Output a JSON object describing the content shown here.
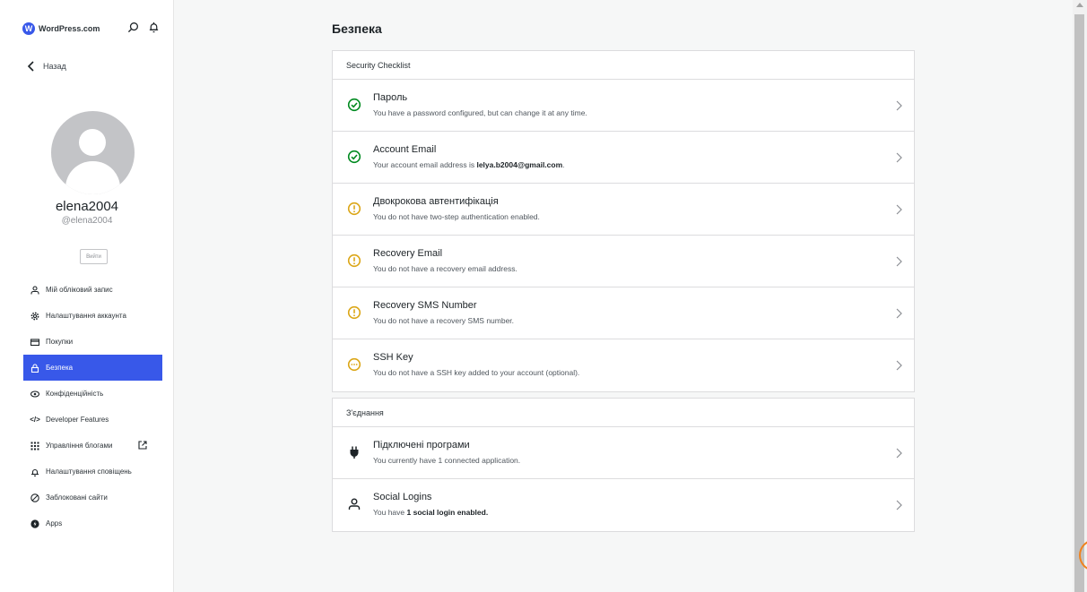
{
  "sidebar": {
    "brand": "WordPress.com",
    "back_label": "Назад",
    "username": "elena2004",
    "handle": "@elena2004",
    "logout_label": "Вийти",
    "items": [
      {
        "label": "Мій обліковий запис",
        "icon": "person-icon"
      },
      {
        "label": "Налаштування аккаунта",
        "icon": "gear-icon"
      },
      {
        "label": "Покупки",
        "icon": "card-icon"
      },
      {
        "label": "Безпека",
        "icon": "lock-icon",
        "active": true
      },
      {
        "label": "Конфіденційність",
        "icon": "eye-icon"
      },
      {
        "label": "Developer Features",
        "icon": "code-icon"
      },
      {
        "label": "Управління блогами",
        "icon": "grid-icon"
      },
      {
        "label": "Налаштування сповіщень",
        "icon": "bell-icon"
      },
      {
        "label": "Заблоковані сайти",
        "icon": "block-icon"
      },
      {
        "label": "Apps",
        "icon": "apps-icon"
      }
    ]
  },
  "main": {
    "title": "Безпека",
    "checklist": {
      "heading": "Security Checklist",
      "rows": [
        {
          "title": "Пароль",
          "desc": "You have a password configured, but can change it at any time.",
          "status": "ok"
        },
        {
          "title": "Account Email",
          "desc_prefix": "Your account email address is ",
          "desc_bold": "lelya.b2004@gmail.com",
          "desc_suffix": ".",
          "status": "ok"
        },
        {
          "title": "Двокрокова автентифікація",
          "desc": "You do not have two-step authentication enabled.",
          "status": "warn"
        },
        {
          "title": "Recovery Email",
          "desc": "You do not have a recovery email address.",
          "status": "warn"
        },
        {
          "title": "Recovery SMS Number",
          "desc": "You do not have a recovery SMS number.",
          "status": "warn"
        },
        {
          "title": "SSH Key",
          "desc": "You do not have a SSH key added to your account (optional).",
          "status": "optional"
        }
      ]
    },
    "connections": {
      "heading": "З'єднання",
      "rows": [
        {
          "title": "Підключені програми",
          "desc": "You currently have 1 connected application.",
          "icon": "plug-icon"
        },
        {
          "title": "Social Logins",
          "desc_prefix": "You have ",
          "desc_bold": "1 social login enabled.",
          "icon": "person-icon"
        }
      ]
    }
  },
  "colors": {
    "accent": "#3858e9",
    "ok": "#008a20",
    "warn": "#dba617"
  }
}
